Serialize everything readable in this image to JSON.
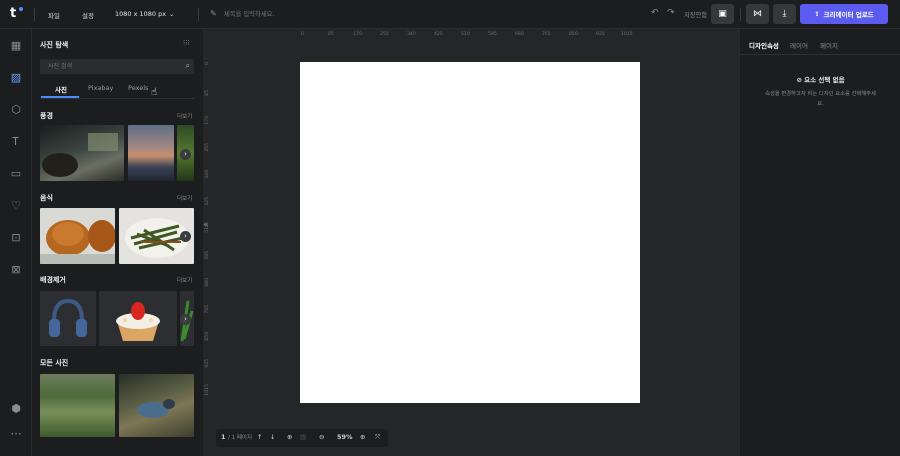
{
  "header": {
    "logo_text": "t",
    "menu_file": "파일",
    "menu_settings": "설정",
    "size_select": "1080 x 1080 px",
    "title_placeholder": "제목을 입력하세요.",
    "shortcut_label": "저장안함",
    "upload_label": "크리에이터 업로드",
    "accent_color": "#5b5bf0"
  },
  "rail": {
    "items": [
      "layout-icon",
      "image-icon",
      "element-icon",
      "text-icon",
      "template-icon",
      "like-icon",
      "upload-icon",
      "profile-icon",
      "brand-icon",
      "more-icon"
    ]
  },
  "panel": {
    "title": "사진 탐색",
    "search_placeholder": "사진 검색",
    "tabs": [
      "사진",
      "Pixabay",
      "Pexels"
    ],
    "active_tab": "사진",
    "sections": [
      {
        "title": "풍경",
        "more": "더보기"
      },
      {
        "title": "음식",
        "more": "더보기"
      },
      {
        "title": "배경제거",
        "more": "더보기"
      },
      {
        "title": "모든 사진",
        "more": ""
      }
    ]
  },
  "canvas": {
    "ruler_top": [
      "0",
      "85",
      "170",
      "255",
      "340",
      "425",
      "510",
      "595",
      "680",
      "765",
      "850",
      "935",
      "1015"
    ],
    "ruler_left": [
      "0",
      "85",
      "170",
      "255",
      "340",
      "425",
      "510",
      "595",
      "680",
      "765",
      "850",
      "935",
      "1015"
    ],
    "page_color": "#ffffff"
  },
  "bottom_bar": {
    "page_current": "1",
    "page_total": "/ 1 페이지",
    "zoom": "59%"
  },
  "right_panel": {
    "tabs": [
      "디자인속성",
      "레이어",
      "페이지"
    ],
    "active_tab": "디자인속성",
    "empty_title": "요소 선택 없음",
    "empty_desc": "속성을 변경하고자 하는 디자인 요소를 선택해주세요."
  }
}
